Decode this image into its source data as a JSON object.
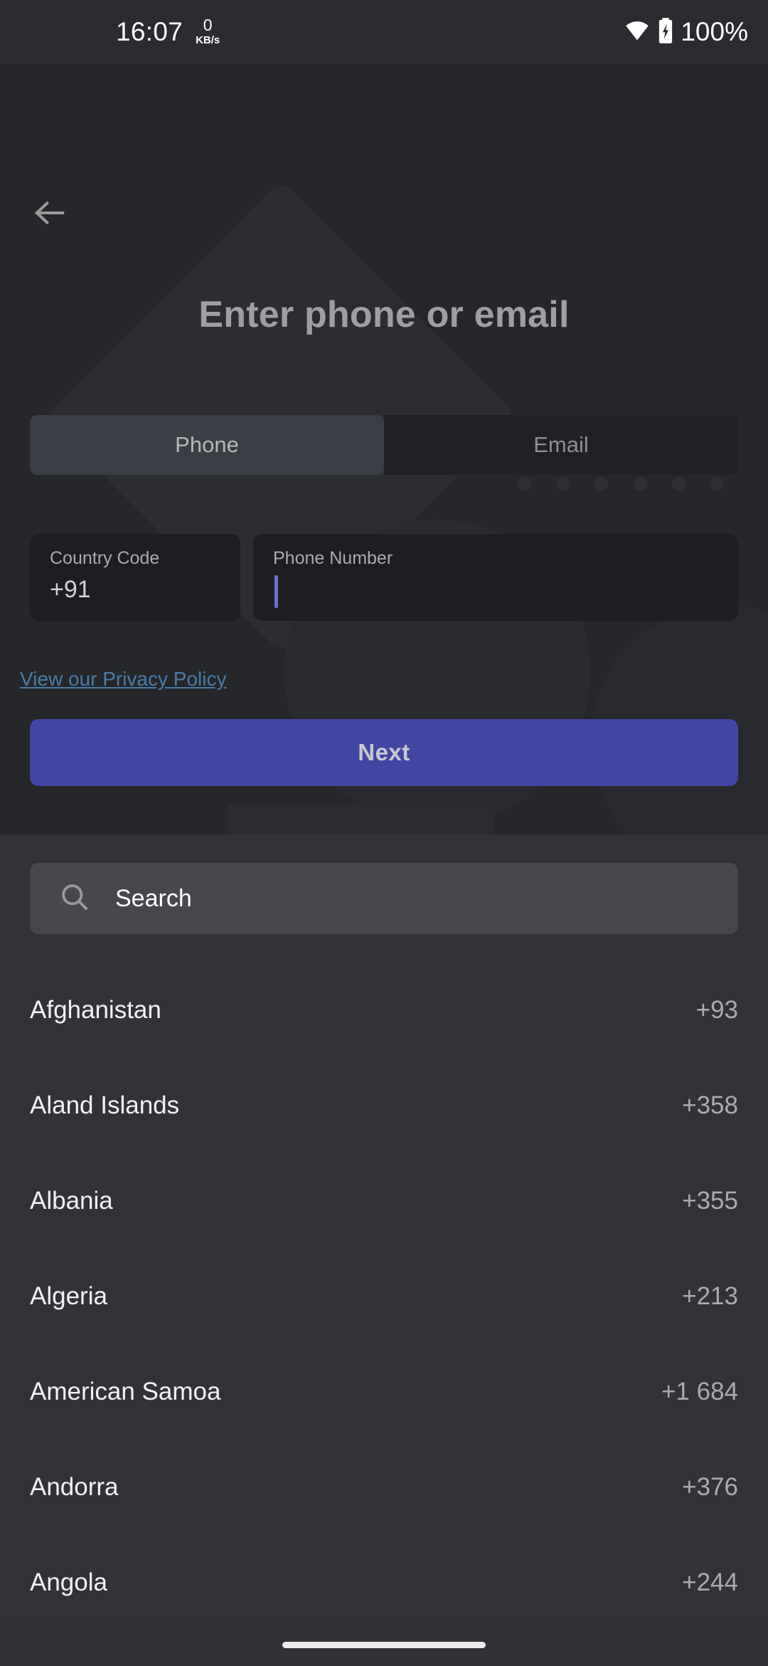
{
  "statusbar": {
    "clock": "16:07",
    "network_speed_value": "0",
    "network_speed_unit": "KB/s",
    "wifi_icon": "wifi-icon",
    "battery_icon": "battery-charging-icon",
    "battery_percent": "100%"
  },
  "header": {
    "back_icon": "back-arrow-icon",
    "title": "Enter phone or email"
  },
  "tabs": [
    {
      "label": "Phone",
      "active": true
    },
    {
      "label": "Email",
      "active": false
    }
  ],
  "form": {
    "country_code": {
      "label": "Country Code",
      "value": "+91"
    },
    "phone_number": {
      "label": "Phone Number",
      "value": ""
    },
    "privacy_link": "View our Privacy Policy",
    "next_label": "Next",
    "accent_color": "#4246a3",
    "link_color": "#4a7ba8",
    "caret_color": "#6b6fd4"
  },
  "sheet": {
    "search": {
      "icon": "search-icon",
      "placeholder": "Search",
      "value": ""
    },
    "countries": [
      {
        "name": "Afghanistan",
        "code": "+93"
      },
      {
        "name": "Aland Islands",
        "code": "+358"
      },
      {
        "name": "Albania",
        "code": "+355"
      },
      {
        "name": "Algeria",
        "code": "+213"
      },
      {
        "name": "American Samoa",
        "code": "+1 684"
      },
      {
        "name": "Andorra",
        "code": "+376"
      },
      {
        "name": "Angola",
        "code": "+244"
      }
    ]
  },
  "navbar": {
    "pill": "home-gesture-pill"
  }
}
